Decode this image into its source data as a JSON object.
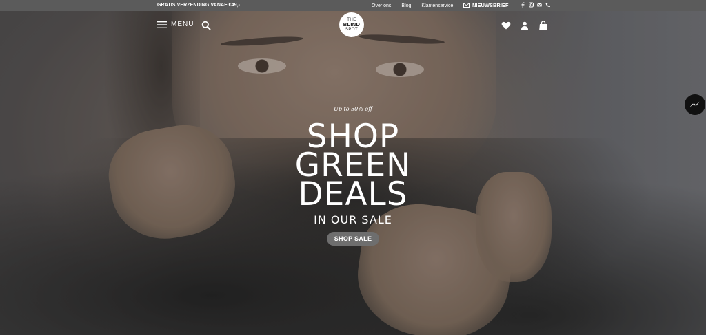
{
  "topbar": {
    "promo": "GRATIS VERZENDING VANAF €49,-",
    "links": [
      "Over ons",
      "Blog",
      "Klantenservice"
    ],
    "newsletter_label": "NIEUWSBRIEF",
    "social_icons": [
      "facebook-icon",
      "instagram-icon",
      "email-icon",
      "phone-icon"
    ]
  },
  "header": {
    "menu_label": "MENU",
    "logo": {
      "line1": "THE",
      "line2": "BLIND",
      "line3": "SPOT"
    },
    "icons": [
      "wishlist-heart-icon",
      "account-user-icon",
      "cart-bag-icon"
    ]
  },
  "hero": {
    "tagline": "Up to 50% off",
    "headline_lines": [
      "SHOP",
      "GREEN",
      "DEALS"
    ],
    "subline": "IN OUR SALE",
    "cta_label": "SHOP SALE"
  },
  "colors": {
    "topbar_bg": "#5b5b5b",
    "cta_bg": "#6e6e6e",
    "text": "#ffffff",
    "messenger_bg": "#111111"
  }
}
